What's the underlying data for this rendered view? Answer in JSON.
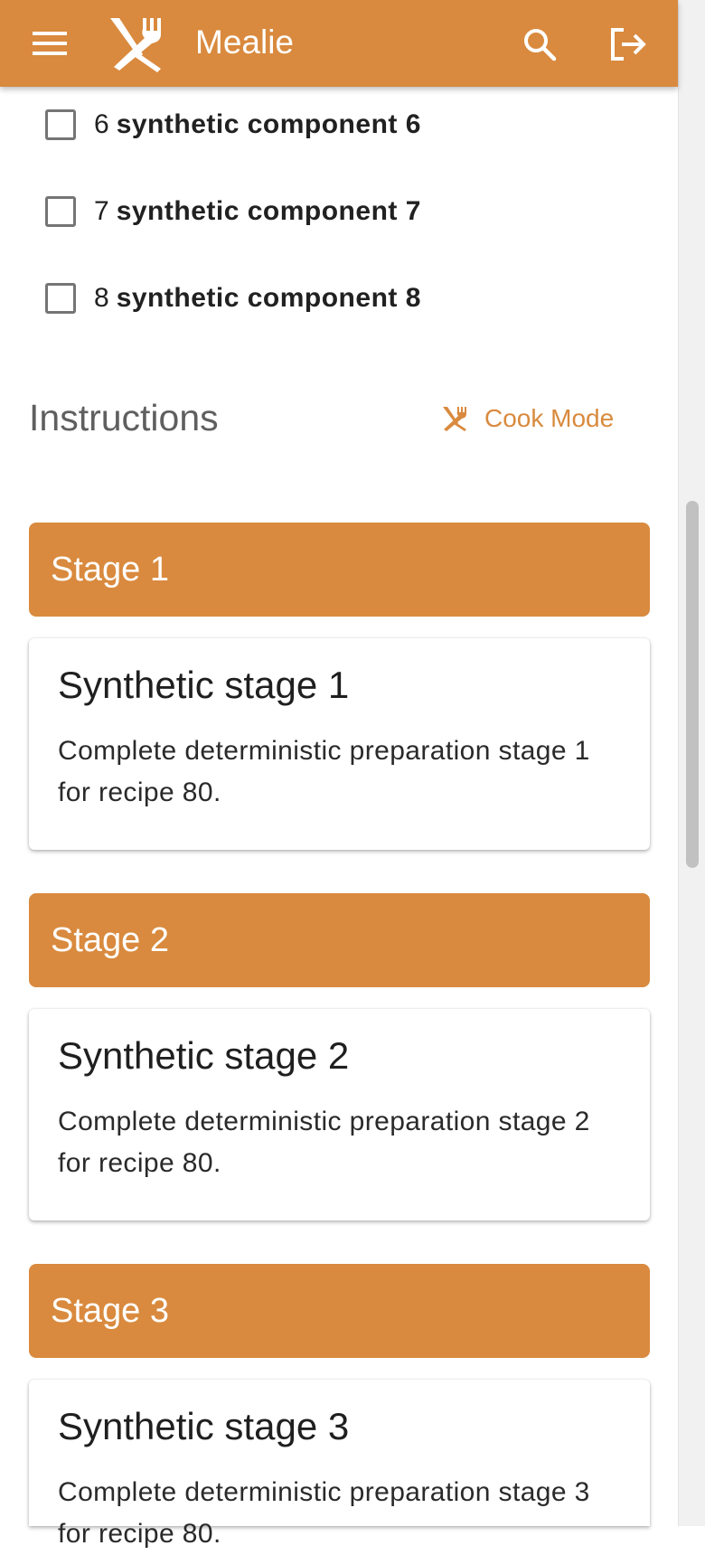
{
  "app": {
    "title": "Mealie"
  },
  "ingredients": [
    {
      "qty": "6",
      "name": "synthetic component 6",
      "checked": false
    },
    {
      "qty": "7",
      "name": "synthetic component 7",
      "checked": false
    },
    {
      "qty": "8",
      "name": "synthetic component 8",
      "checked": false
    }
  ],
  "instructions": {
    "title": "Instructions",
    "cook_mode_label": "Cook Mode"
  },
  "stages": [
    {
      "header": "Stage 1",
      "title": "Synthetic stage 1",
      "text": "Complete deterministic preparation stage 1 for recipe 80."
    },
    {
      "header": "Stage 2",
      "title": "Synthetic stage 2",
      "text": "Complete deterministic preparation stage 2 for recipe 80."
    },
    {
      "header": "Stage 3",
      "title": "Synthetic stage 3",
      "text": "Complete deterministic preparation stage 3 for recipe 80."
    }
  ],
  "icons": {
    "menu": "menu-icon",
    "logo": "fork-knife-icon",
    "search": "search-icon",
    "logout": "logout-icon",
    "cook_mode": "fork-knife-icon"
  },
  "colors": {
    "primary": "#d98a3e",
    "text": "#212121"
  }
}
